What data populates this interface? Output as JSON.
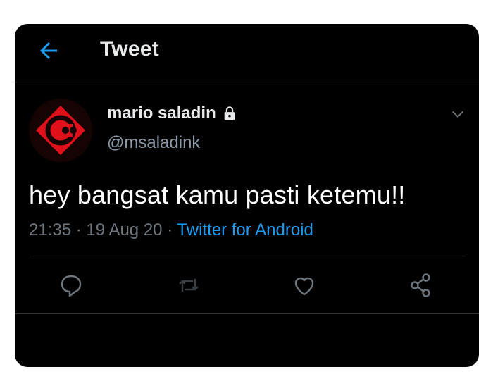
{
  "header": {
    "title": "Tweet",
    "back_icon": "arrow-left-icon"
  },
  "author": {
    "name": "mario saladin",
    "handle": "@msaladink",
    "protected_icon": "lock-icon"
  },
  "tweet": {
    "text": "hey bangsat kamu pasti ketemu!!",
    "time": "21:35",
    "date": "19 Aug 20",
    "source": "Twitter for Android"
  },
  "actions": [
    "reply-icon",
    "retweet-icon",
    "like-icon",
    "share-icon"
  ],
  "colors": {
    "background": "#000000",
    "accent": "#1d9bf0",
    "text": "#e7e9ea",
    "muted": "#6e767d",
    "avatar_red": "#e0101a"
  }
}
